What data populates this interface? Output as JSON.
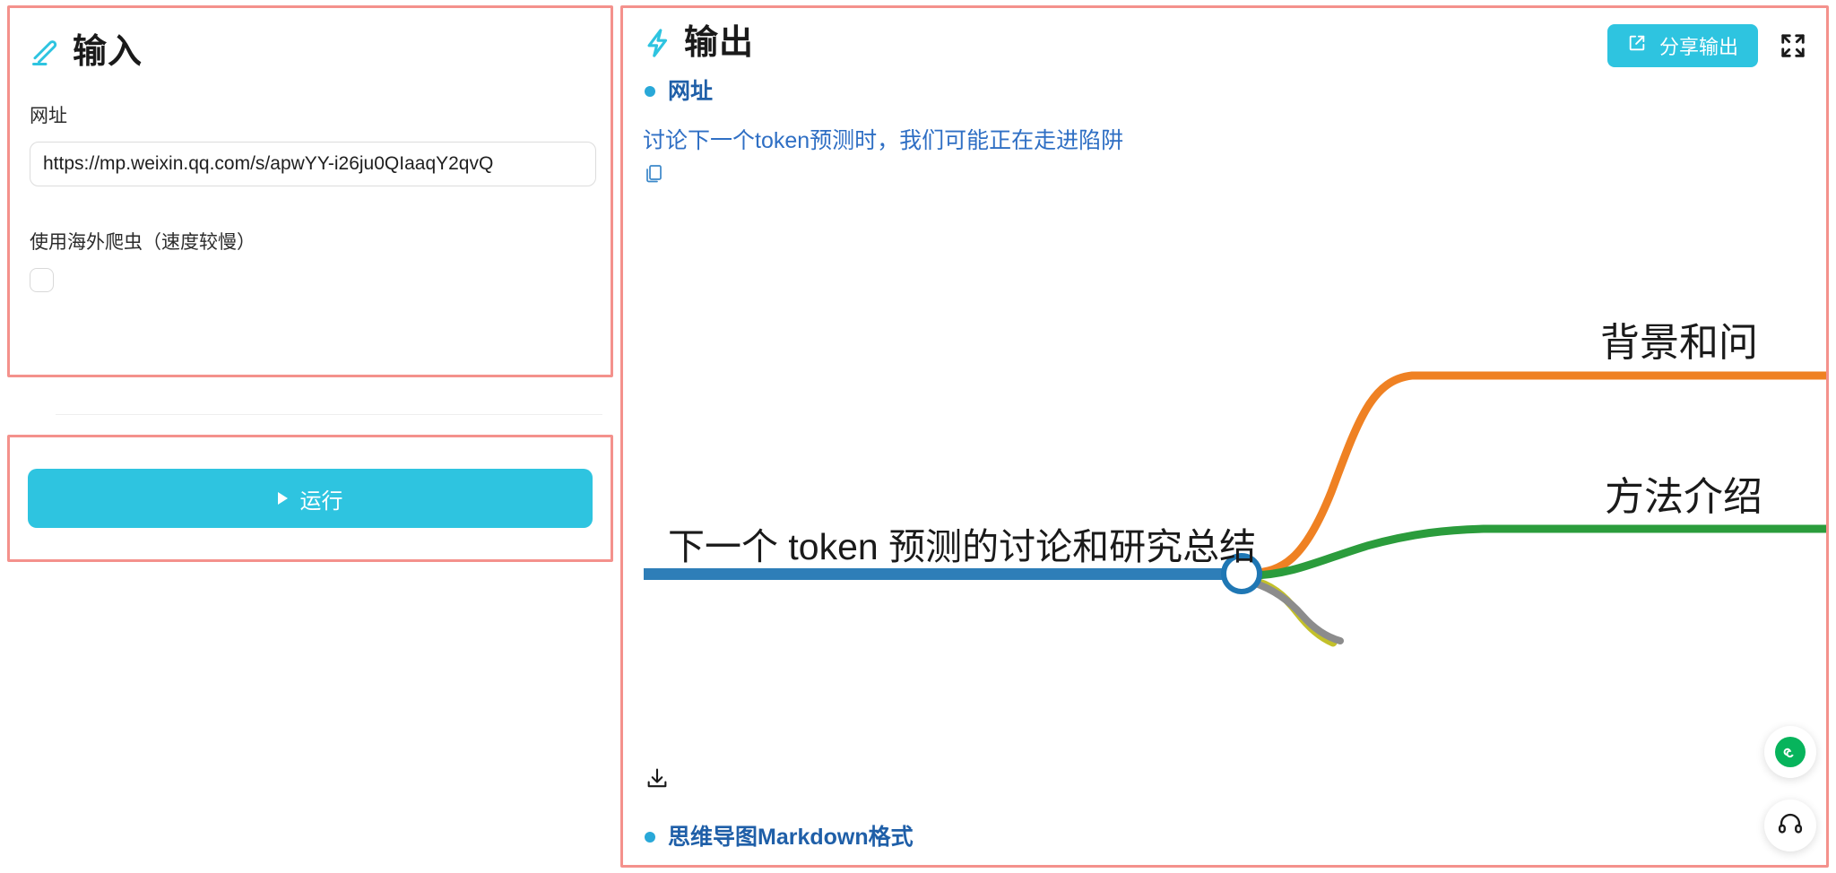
{
  "input_panel": {
    "icon": "pencil-icon",
    "title": "输入",
    "url_field": {
      "label": "网址",
      "value": "https://mp.weixin.qq.com/s/apwYY-i26ju0QIaaqY2qvQ",
      "placeholder": "网址"
    },
    "overseas_crawler": {
      "label": "使用海外爬虫（速度较慢）",
      "checked": false
    },
    "run_button": {
      "label": "运行",
      "icon": "play-icon"
    }
  },
  "output_panel": {
    "icon": "lightning-bolt-icon",
    "title": "输出",
    "share_button": {
      "label": "分享输出",
      "icon": "external-link-icon"
    },
    "expand_button": {
      "icon": "fullscreen-expand-icon"
    },
    "sections": [
      {
        "label": "网址"
      },
      {
        "label": "思维导图Markdown格式"
      }
    ],
    "result_title": "讨论下一个token预测时，我们可能正在走进陷阱",
    "copy_icon": "copy-icon",
    "download_icon": "download-icon"
  },
  "mindmap": {
    "root": "下一个 token 预测的讨论和研究总结",
    "branches": [
      {
        "label": "背景和问",
        "color": "#ef8123"
      },
      {
        "label": "方法介绍",
        "color": "#2b9c3c"
      },
      {
        "label": "",
        "color": "#c3c02a"
      },
      {
        "label": "",
        "color": "#8c8c8c"
      }
    ],
    "root_line_color": "#2e7eb8",
    "root_node_stroke": "#1f77b4"
  },
  "floating_buttons": [
    {
      "name": "wechat-miniprogram-button",
      "icon": "wechat-miniprogram-icon",
      "color": "#07b45c"
    },
    {
      "name": "support-button",
      "icon": "headphones-icon",
      "color": "#1a1a1a"
    }
  ],
  "colors": {
    "accent": "#2ec4e0",
    "highlight_border": "#f4918c",
    "link_blue": "#2f6fc4",
    "heading_blue": "#1f5fa8"
  }
}
